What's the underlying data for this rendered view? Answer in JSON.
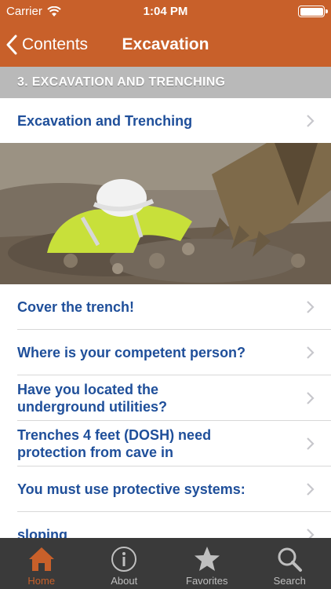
{
  "status_bar": {
    "carrier": "Carrier",
    "time": "1:04 PM"
  },
  "nav": {
    "back_label": "Contents",
    "title": "Excavation"
  },
  "section_header": "3.  EXCAVATION AND TRENCHING",
  "rows": [
    "Excavation and Trenching",
    "Cover the trench!",
    "Where is your competent person?",
    "Have you located the underground utilities?",
    "Trenches 4 feet (DOSH) need protection from cave in",
    "You must use protective systems:",
    "sloping"
  ],
  "tabs": [
    {
      "label": "Home",
      "icon": "home-icon",
      "active": true
    },
    {
      "label": "About",
      "icon": "info-icon",
      "active": false
    },
    {
      "label": "Favorites",
      "icon": "star-icon",
      "active": false
    },
    {
      "label": "Search",
      "icon": "search-icon",
      "active": false
    }
  ],
  "colors": {
    "brand": "#c8602a",
    "link": "#1f4f9a",
    "tabbar": "#3a3a3a",
    "header_gray": "#b9b9b9"
  }
}
